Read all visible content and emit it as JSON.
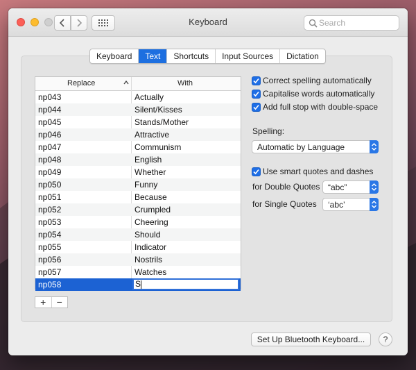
{
  "window": {
    "title": "Keyboard"
  },
  "search": {
    "placeholder": "Search"
  },
  "tabs": [
    "Keyboard",
    "Text",
    "Shortcuts",
    "Input Sources",
    "Dictation"
  ],
  "active_tab": "Text",
  "table": {
    "headers": {
      "replace": "Replace",
      "with": "With"
    },
    "rows": [
      {
        "replace": "np043",
        "with": "Actually"
      },
      {
        "replace": "np044",
        "with": "Silent/Kisses"
      },
      {
        "replace": "np045",
        "with": "Stands/Mother"
      },
      {
        "replace": "np046",
        "with": "Attractive"
      },
      {
        "replace": "np047",
        "with": "Communism"
      },
      {
        "replace": "np048",
        "with": "English"
      },
      {
        "replace": "np049",
        "with": "Whether"
      },
      {
        "replace": "np050",
        "with": "Funny"
      },
      {
        "replace": "np051",
        "with": "Because"
      },
      {
        "replace": "np052",
        "with": "Crumpled"
      },
      {
        "replace": "np053",
        "with": "Cheering"
      },
      {
        "replace": "np054",
        "with": "Should"
      },
      {
        "replace": "np055",
        "with": "Indicator"
      },
      {
        "replace": "np056",
        "with": "Nostrils"
      },
      {
        "replace": "np057",
        "with": "Watches"
      }
    ],
    "editing_row": {
      "replace": "np058",
      "with": "S"
    }
  },
  "table_controls": {
    "add": "+",
    "remove": "−"
  },
  "options": {
    "correct_spelling": {
      "label": "Correct spelling automatically",
      "checked": true
    },
    "capitalise": {
      "label": "Capitalise words automatically",
      "checked": true
    },
    "full_stop": {
      "label": "Add full stop with double-space",
      "checked": true
    },
    "spelling_label": "Spelling:",
    "spelling_value": "Automatic by Language",
    "smart_quotes": {
      "label": "Use smart quotes and dashes",
      "checked": true
    },
    "double_quotes_label": "for Double Quotes",
    "double_quotes_value": "“abc”",
    "single_quotes_label": "for Single Quotes",
    "single_quotes_value": "‘abc’"
  },
  "buttons": {
    "bluetooth": "Set Up Bluetooth Keyboard...",
    "help": "?"
  },
  "colors": {
    "accent": "#1d6fe0",
    "selection": "#1c62d3"
  }
}
